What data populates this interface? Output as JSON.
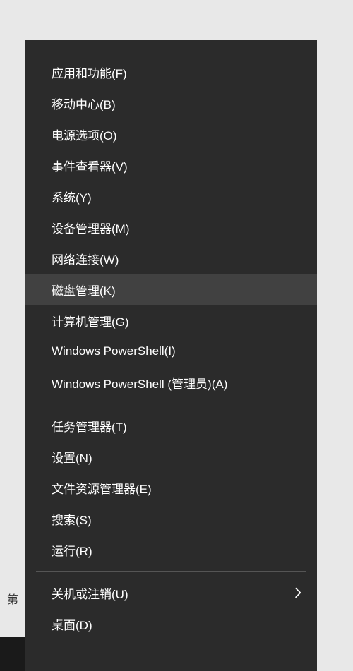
{
  "background": {
    "text_fragment": "第"
  },
  "menu": {
    "groups": [
      {
        "items": [
          {
            "label": "应用和功能(F)",
            "name": "menu-item-apps-features",
            "submenu": false,
            "highlighted": false
          },
          {
            "label": "移动中心(B)",
            "name": "menu-item-mobility-center",
            "submenu": false,
            "highlighted": false
          },
          {
            "label": "电源选项(O)",
            "name": "menu-item-power-options",
            "submenu": false,
            "highlighted": false
          },
          {
            "label": "事件查看器(V)",
            "name": "menu-item-event-viewer",
            "submenu": false,
            "highlighted": false
          },
          {
            "label": "系统(Y)",
            "name": "menu-item-system",
            "submenu": false,
            "highlighted": false
          },
          {
            "label": "设备管理器(M)",
            "name": "menu-item-device-manager",
            "submenu": false,
            "highlighted": false
          },
          {
            "label": "网络连接(W)",
            "name": "menu-item-network-connections",
            "submenu": false,
            "highlighted": false
          },
          {
            "label": "磁盘管理(K)",
            "name": "menu-item-disk-management",
            "submenu": false,
            "highlighted": true
          },
          {
            "label": "计算机管理(G)",
            "name": "menu-item-computer-management",
            "submenu": false,
            "highlighted": false
          },
          {
            "label": "Windows PowerShell(I)",
            "name": "menu-item-powershell",
            "submenu": false,
            "highlighted": false
          },
          {
            "label": "Windows PowerShell (管理员)(A)",
            "name": "menu-item-powershell-admin",
            "submenu": false,
            "highlighted": false
          }
        ]
      },
      {
        "items": [
          {
            "label": "任务管理器(T)",
            "name": "menu-item-task-manager",
            "submenu": false,
            "highlighted": false
          },
          {
            "label": "设置(N)",
            "name": "menu-item-settings",
            "submenu": false,
            "highlighted": false
          },
          {
            "label": "文件资源管理器(E)",
            "name": "menu-item-file-explorer",
            "submenu": false,
            "highlighted": false
          },
          {
            "label": "搜索(S)",
            "name": "menu-item-search",
            "submenu": false,
            "highlighted": false
          },
          {
            "label": "运行(R)",
            "name": "menu-item-run",
            "submenu": false,
            "highlighted": false
          }
        ]
      },
      {
        "items": [
          {
            "label": "关机或注销(U)",
            "name": "menu-item-shutdown-signout",
            "submenu": true,
            "highlighted": false
          },
          {
            "label": "桌面(D)",
            "name": "menu-item-desktop",
            "submenu": false,
            "highlighted": false
          }
        ]
      }
    ]
  }
}
